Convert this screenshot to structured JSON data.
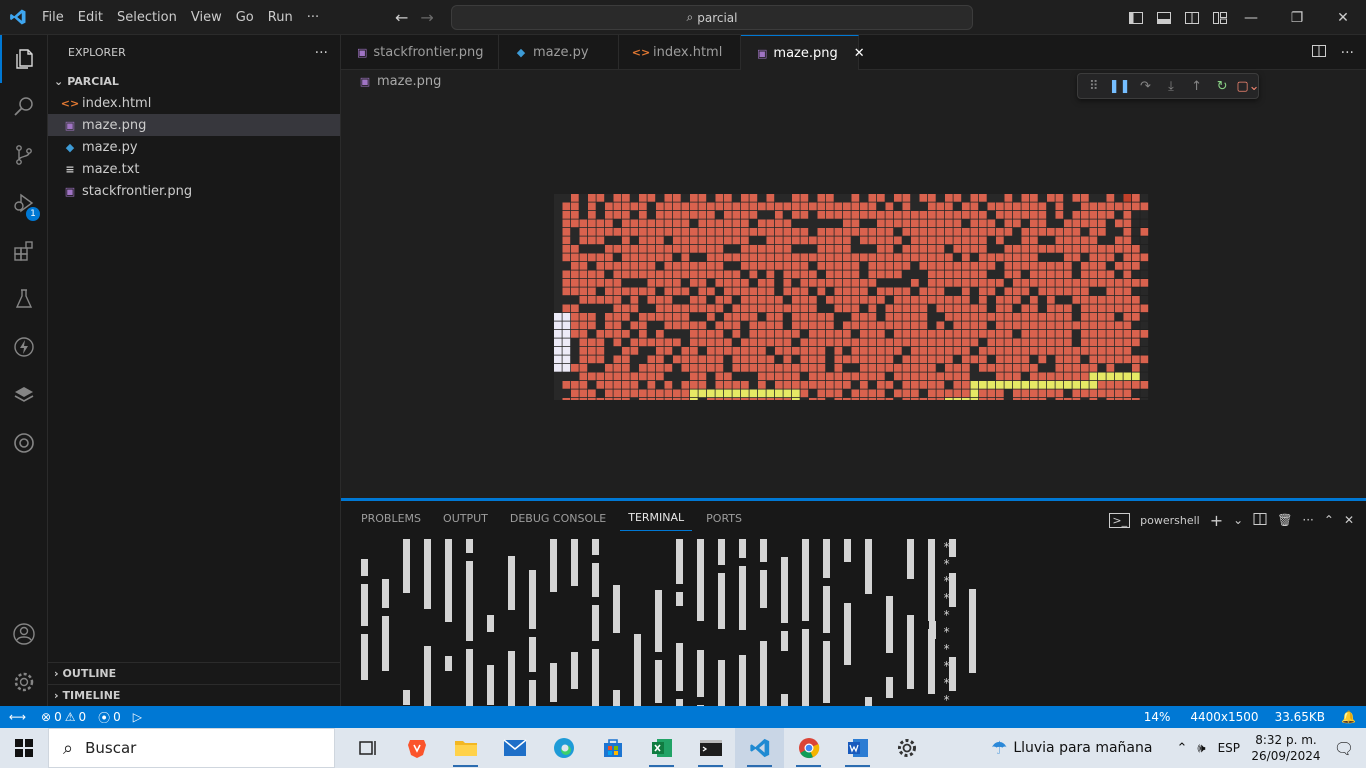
{
  "menu": [
    "File",
    "Edit",
    "Selection",
    "View",
    "Go",
    "Run",
    "···"
  ],
  "search": {
    "text": "parcial"
  },
  "explorer": {
    "title": "EXPLORER",
    "more": "···",
    "folder": "PARCIAL",
    "files": [
      {
        "name": "index.html",
        "icon": "html-file-icon",
        "glyph": "<>",
        "color": "#e37933"
      },
      {
        "name": "maze.png",
        "icon": "image-file-icon",
        "glyph": "▣",
        "color": "#a074c4",
        "selected": true
      },
      {
        "name": "maze.py",
        "icon": "python-file-icon",
        "glyph": "◆",
        "color": "#3d9bd6"
      },
      {
        "name": "maze.txt",
        "icon": "text-file-icon",
        "glyph": "≡",
        "color": "#cccccc"
      },
      {
        "name": "stackfrontier.png",
        "icon": "image-file-icon",
        "glyph": "▣",
        "color": "#a074c4"
      }
    ],
    "outline": "OUTLINE",
    "timeline": "TIMELINE"
  },
  "debug_badge": "1",
  "tabs": [
    {
      "name": "stackfrontier.png",
      "glyph": "▣",
      "color": "#a074c4"
    },
    {
      "name": "maze.py",
      "glyph": "◆",
      "color": "#3d9bd6"
    },
    {
      "name": "index.html",
      "glyph": "<>",
      "color": "#e37933"
    },
    {
      "name": "maze.png",
      "glyph": "▣",
      "color": "#a074c4",
      "active": true,
      "close": "✕"
    }
  ],
  "breadcrumb": "maze.png",
  "panel": {
    "tabs": [
      "PROBLEMS",
      "OUTPUT",
      "DEBUG CONSOLE",
      "TERMINAL",
      "PORTS"
    ],
    "active": "TERMINAL",
    "shell": "powershell"
  },
  "terminal": {
    "stars": [
      "*",
      "*",
      "*",
      "*",
      "*",
      "*",
      "*",
      "*",
      "*",
      "*"
    ]
  },
  "status": {
    "errors": "0",
    "warnings": "0",
    "ports": "0",
    "zoom": "14%",
    "dimensions": "4400x1500",
    "size": "33.65KB"
  },
  "taskbar": {
    "search": "Buscar",
    "weather": "Lluvia para mañana",
    "lang": "ESP",
    "time": "8:32 p. m.",
    "date": "26/09/2024"
  },
  "colors": {
    "accent": "#0078d4",
    "maze_cell": "#d9624e",
    "maze_wall": "#282828",
    "maze_path": "#e6e965",
    "maze_start": "#c2402a",
    "maze_goal": "#3c8c3c",
    "maze_explored": "#eceaf7"
  }
}
